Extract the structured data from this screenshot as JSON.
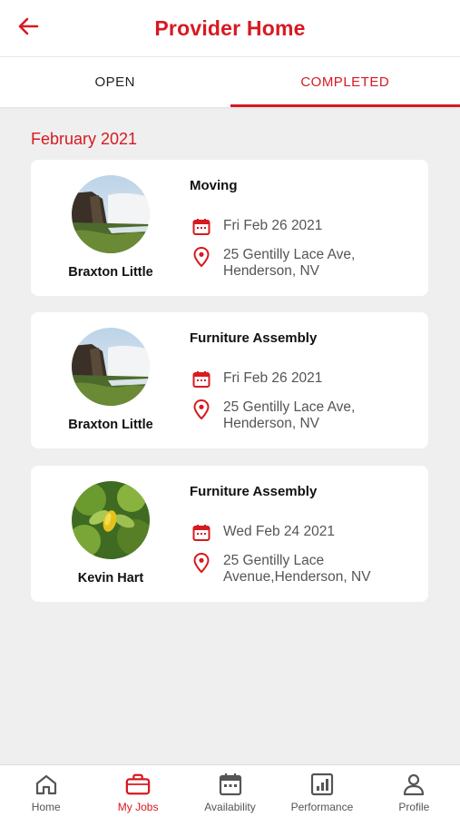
{
  "header": {
    "title": "Provider Home",
    "back_icon": "arrow-left-icon"
  },
  "tabs": [
    {
      "label": "OPEN",
      "active": false
    },
    {
      "label": "COMPLETED",
      "active": true
    }
  ],
  "section": {
    "title": "February 2021"
  },
  "jobs": [
    {
      "provider": "Braxton Little",
      "service": "Moving",
      "date": "Fri Feb 26 2021",
      "address": "25 Gentilly Lace Ave, Henderson, NV",
      "avatar": "waterfall-photo"
    },
    {
      "provider": "Braxton Little",
      "service": "Furniture Assembly",
      "date": "Fri Feb 26 2021",
      "address": "25 Gentilly Lace Ave, Henderson, NV",
      "avatar": "waterfall-photo"
    },
    {
      "provider": "Kevin Hart",
      "service": "Furniture Assembly",
      "date": "Wed Feb 24 2021",
      "address": "25 Gentilly Lace Avenue,Henderson, NV",
      "avatar": "leaves-photo"
    }
  ],
  "bottom_nav": [
    {
      "label": "Home",
      "icon": "home-icon",
      "active": false
    },
    {
      "label": "My Jobs",
      "icon": "briefcase-icon",
      "active": true
    },
    {
      "label": "Availability",
      "icon": "calendar-icon",
      "active": false
    },
    {
      "label": "Performance",
      "icon": "bar-chart-icon",
      "active": false
    },
    {
      "label": "Profile",
      "icon": "user-icon",
      "active": false
    }
  ],
  "colors": {
    "accent": "#d71920",
    "background": "#efefef",
    "card": "#ffffff"
  }
}
